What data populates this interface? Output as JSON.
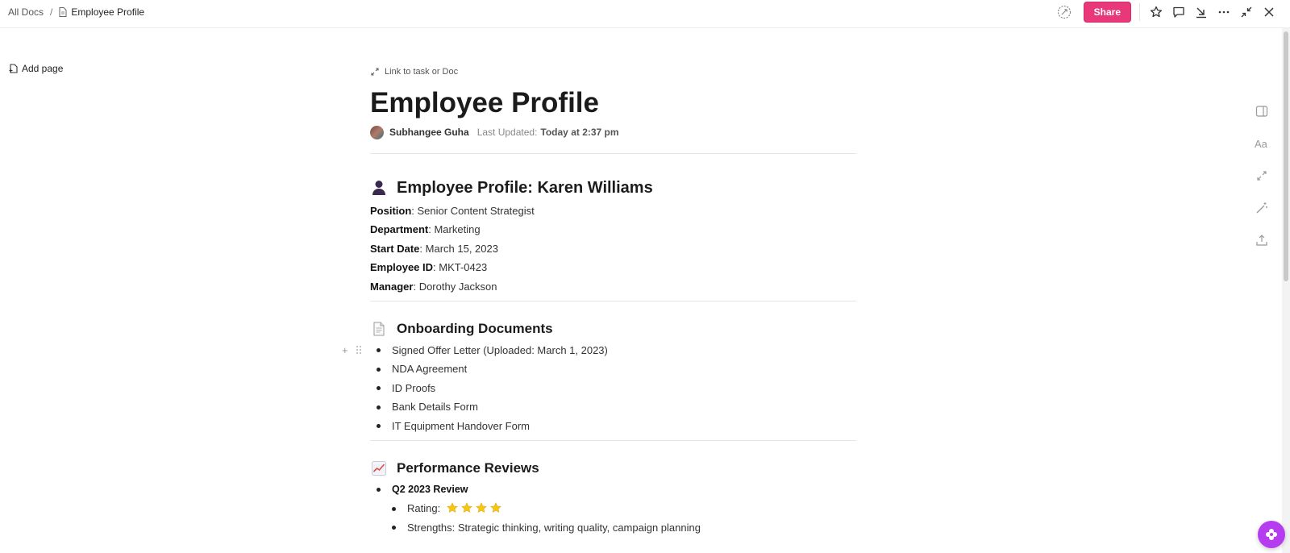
{
  "breadcrumb": {
    "root": "All Docs",
    "separator": "/",
    "current": "Employee Profile"
  },
  "toolbar": {
    "share_label": "Share",
    "icons": [
      "ai-circle-icon",
      "star-icon",
      "comment-icon",
      "download-icon",
      "more-icon",
      "collapse-icon",
      "close-icon"
    ]
  },
  "sidebar": {
    "add_page_label": "Add page"
  },
  "doc": {
    "link_task_label": "Link to task or Doc",
    "title": "Employee Profile",
    "author": "Subhangee Guha",
    "updated_label": "Last Updated:",
    "updated_value": "Today at 2:37 pm",
    "profile": {
      "emoji": "bust-silhouette-icon",
      "heading": "Employee Profile: Karen Williams",
      "fields": [
        {
          "label": "Position",
          "value": ": Senior Content Strategist"
        },
        {
          "label": "Department",
          "value": ": Marketing"
        },
        {
          "label": "Start Date",
          "value": ": March 15, 2023"
        },
        {
          "label": "Employee ID",
          "value": ": MKT-0423"
        },
        {
          "label": "Manager",
          "value": ": Dorothy Jackson"
        }
      ]
    },
    "onboarding": {
      "emoji": "page-icon",
      "heading": "Onboarding Documents",
      "items": [
        "Signed Offer Letter (Uploaded: March 1, 2023)",
        "NDA Agreement",
        "ID Proofs",
        "Bank Details Form",
        "IT Equipment Handover Form"
      ]
    },
    "performance": {
      "emoji": "chart-increasing-icon",
      "heading": "Performance Reviews",
      "review_title": "Q2 2023 Review",
      "rating_label": "Rating:",
      "rating_stars": 4,
      "strengths": "Strengths: Strategic thinking, writing quality, campaign planning"
    }
  },
  "colors": {
    "accent": "#e8387a",
    "fab": "#b63cf0",
    "star": "#f5c518"
  }
}
